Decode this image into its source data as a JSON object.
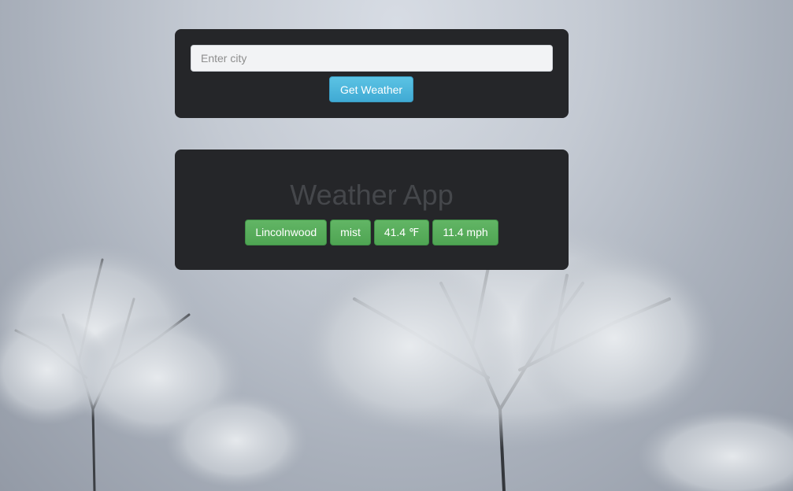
{
  "search": {
    "placeholder": "Enter city",
    "value": "",
    "button_label": "Get Weather"
  },
  "result": {
    "title": "Weather App",
    "city": "Lincolnwood",
    "condition": "mist",
    "temperature": "41.4 ℉",
    "wind": "11.4 mph"
  },
  "background": {
    "description_icon": "frosted-trees-icon"
  },
  "colors": {
    "panel": "#252629",
    "button_info": "#5bc0de",
    "badge_success": "#5cb85c",
    "title_text": "#45474b"
  }
}
